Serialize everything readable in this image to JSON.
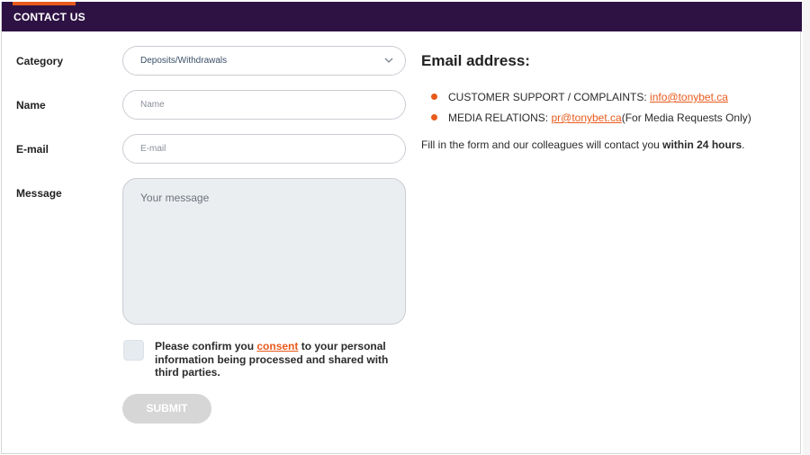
{
  "header": {
    "title": "CONTACT US"
  },
  "form": {
    "category": {
      "label": "Category",
      "value": "Deposits/Withdrawals"
    },
    "name": {
      "label": "Name",
      "placeholder": "Name"
    },
    "email": {
      "label": "E-mail",
      "placeholder": "E-mail"
    },
    "message": {
      "label": "Message",
      "placeholder": "Your message"
    },
    "consent": {
      "prefix": "Please confirm you ",
      "link": "consent",
      "suffix": " to your personal information being processed and shared with third parties."
    },
    "submit_label": "SUBMIT"
  },
  "info": {
    "title": "Email address:",
    "items": [
      {
        "label": "CUSTOMER SUPPORT / COMPLAINTS: ",
        "email": "info@tonybet.ca",
        "note": ""
      },
      {
        "label": "MEDIA RELATIONS: ",
        "email": "pr@tonybet.ca",
        "note": "(For Media Requests Only)"
      }
    ],
    "note_prefix": "Fill in the form and our colleagues will contact you ",
    "note_bold": "within 24 hours",
    "note_suffix": "."
  },
  "colors": {
    "header_bg": "#2e1244",
    "accent": "#e85a1c",
    "submit_disabled": "#d6d6d6"
  },
  "icons": {
    "select_caret": "chevron-down-icon"
  }
}
